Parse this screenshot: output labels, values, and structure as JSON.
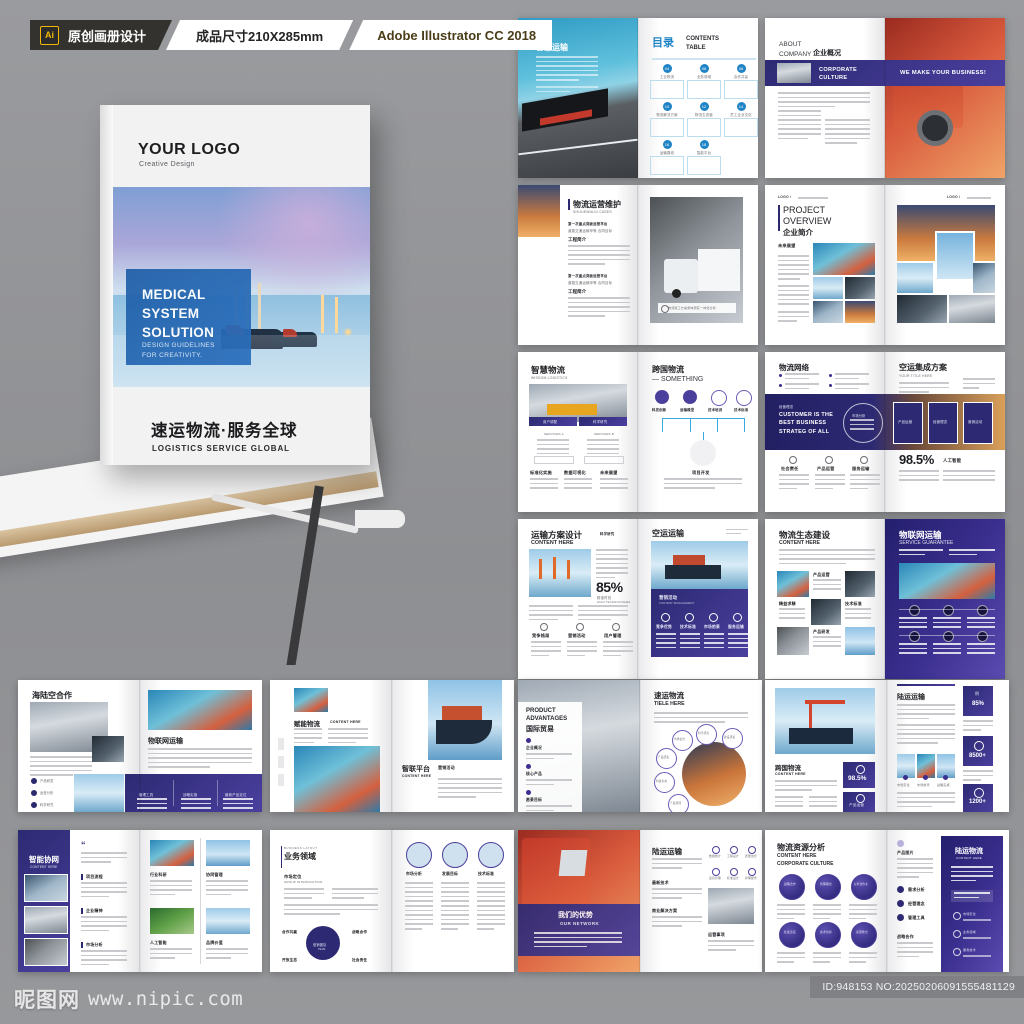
{
  "ribbon": {
    "badge": "Ai",
    "tag1": "原创画册设计",
    "tag2": "成品尺寸210X285mm",
    "tag3": "Adobe Illustrator CC 2018"
  },
  "cover": {
    "logo": "YOUR LOGO",
    "logo_sub": "Creative Design",
    "title": "MEDICAL\nSYSTEM\nSOLUTION",
    "subtitle": "DESIGN GUIDELINES\nFOR CREATIVITY.",
    "bottom_cn": "速运物流·服务全球",
    "bottom_en": "LOGISTICS SERVICE GLOBAL"
  },
  "watermark": {
    "site_cn": "昵图网",
    "site_url": "www.nipic.com",
    "id_text": "ID:948153 NO:20250206091555481129"
  },
  "spreads": [
    {
      "id": "spread-contents",
      "left_title": "智慧运输",
      "left_quote": "“",
      "right_title_cn": "目录",
      "right_title_en": "CONTENTS\nTABLE",
      "toc_items": [
        {
          "num": "04",
          "label": "工业物流"
        },
        {
          "num": "06",
          "label": "业务领域"
        },
        {
          "num": "08",
          "label": "合作共赢"
        },
        {
          "num": "10",
          "label": "物流解决方案"
        },
        {
          "num": "12",
          "label": "物流生态链"
        },
        {
          "num": "14",
          "label": "员工企业文化"
        },
        {
          "num": "16",
          "label": "运输路线"
        },
        {
          "num": "18",
          "label": "智能平台"
        }
      ],
      "accent": "#1f84c6"
    },
    {
      "id": "spread-about",
      "left_title_en": "ABOUT\nCOMPANY",
      "left_title_cn": "企业概况",
      "band_title": "CORPORATE\nCULTURE",
      "band_slogan": "WE MAKE YOUR BUSINESS!",
      "accent": "#2b2a70"
    },
    {
      "id": "spread-ops",
      "left_title_cn": "物流运营维护",
      "left_title_en": "SHIJUEWULIU CASES",
      "sec1": "第一次重点突破运营平台",
      "sec1b": "道路交通运输甲等 合同目标",
      "sec1c": "工程简介",
      "sec2": "第一次重点突破运营平台",
      "sec2b": "道路交通运输甲等 合同目标",
      "sec2c": "工程简介",
      "caption": "物流施工方案整体研究一体化分析",
      "accent": "#2b2a70"
    },
    {
      "id": "spread-project",
      "logo_mark": "LOGO /",
      "title_en": "PROJECT\nOVERVIEW",
      "title_cn": "企业简介",
      "sec": "未来展望",
      "accent": "#2b2a70"
    },
    {
      "id": "spread-smart",
      "left_title": "智慧物流",
      "left_sub": "WISDOM LOGISTICS",
      "tab1": "用户调配",
      "tab2": "科学研究",
      "svcA": "SERVICES A",
      "svcB": "SERVICES B",
      "foot": [
        "标准化实施",
        "数据可视化",
        "未来展望"
      ],
      "right_title_cn": "跨国物流",
      "right_title_en": "— SOMETHING",
      "icons": [
        "科技创新",
        "运输模型",
        "技术培训",
        "技术标准"
      ],
      "center_label": "项目开发",
      "accent": "#5b4aa8"
    },
    {
      "id": "spread-network",
      "left_title": "物流网络",
      "right_title_cn": "空运集成方案",
      "right_title_en": "YOUR TITLE HERE",
      "band_cn": "经营理念",
      "band_en": "CUSTOMER IS THE\nBEST BUSINESS\nSTRATEG OF ALL",
      "ring_label": "市场分析",
      "cards": [
        "产品运营",
        "经营理念",
        "营销活动"
      ],
      "foot": [
        "社会责任",
        "产品运营",
        "服务运输"
      ],
      "stat": "98.5%",
      "stat_label": "人工智能",
      "accent": "#2b2a70"
    },
    {
      "id": "spread-plan",
      "left_title_cn": "运输方案设计",
      "left_title_en": "CONTENT HERE",
      "left_tag": "科学研究",
      "stat": "85%",
      "stat_cn": "精准时效",
      "stat_en": "HIGH TECHNOLOGIES",
      "foot": [
        "竞争格局",
        "营销活动",
        "用户管理"
      ],
      "right_title": "空运运输",
      "right_band_cn": "营销活动",
      "right_band_en": "CONTENT MANAGEMENT",
      "right_cols": [
        "竞争优势",
        "技术标准",
        "市场前景",
        "服务运输"
      ],
      "accent": "#2b2a70"
    },
    {
      "id": "spread-eco",
      "left_title_cn": "物流生态建设",
      "left_title_en": "CONTENT HERE",
      "cells": [
        "产品运营",
        "精益求精",
        "技术标准",
        "产品研发"
      ],
      "right_title_cn": "物联网运输",
      "right_title_en": "SERVICE GUARANTEE",
      "accent": "#3b2f8f"
    },
    {
      "id": "spread-sea-air",
      "left_title": "海陆空合作",
      "right_title": "物联网运输",
      "list": [
        "产品研发",
        "运营分析",
        "科学研究"
      ],
      "band_items": [
        "管理工具",
        "战略实施",
        "最新产品定位"
      ],
      "accent": "#2b2a70"
    },
    {
      "id": "spread-empower",
      "left_title_cn": "赋能物流",
      "left_title_en": "CONTENT HERE",
      "right_title_cn": "智联平台",
      "right_title_en": "CONTENT HERE",
      "right_sub": "营销活动",
      "accent": "#2b2a70"
    },
    {
      "id": "spread-advantages",
      "left_title_en": "PRODUCT\nADVANTAGES",
      "left_title_cn": "国际贸易",
      "left_items": [
        "企业概况",
        "核心产品",
        "愿景目标"
      ],
      "right_title_cn": "速运物流",
      "right_title_en": "TIELE HERE",
      "bubbles": [
        "市场定位",
        "科学研究",
        "建设研发",
        "产品研发",
        "科技生态",
        "产品管理"
      ],
      "accent": "#4a3f9e"
    },
    {
      "id": "spread-cross",
      "left_title_cn": "跨国物流",
      "left_title_en": "CONTENT HERE",
      "left_stat": "98.5%",
      "left_stat2": "产品运营",
      "right_title": "陆运运输",
      "stats": [
        {
          "label": "例",
          "value": "85%"
        },
        {
          "label": "",
          "value": "8500+"
        },
        {
          "label": "",
          "value": "1200+"
        }
      ],
      "thumbs": [
        "市场定位",
        "市场前景",
        "战略实施"
      ],
      "accent": "#3b2f8f"
    },
    {
      "id": "spread-collab",
      "left_title_cn": "智能协网",
      "left_title_en": "CONTENT HERE",
      "mid_items": [
        "项目流程",
        "企业精神",
        "市场分析"
      ],
      "right_items": [
        "行业科研",
        "协同管理",
        "人工智能",
        "品牌价值"
      ],
      "accent": "#2b2a70"
    },
    {
      "id": "spread-business",
      "left_kicker": "BUSINESS LAYOUT",
      "left_title": "业务领域",
      "left_sec_cn": "市场定位",
      "left_sec_en": "GROUP INTRODUCTION",
      "nodes": [
        "合作共赢",
        "战略合作",
        "开放生态",
        "社会责任"
      ],
      "bubble_cn": "营销团队",
      "bubble_en": "TEAM",
      "right_cards": [
        "市场分析",
        "发展目标",
        "技术标准"
      ],
      "accent": "#2d2a73"
    },
    {
      "id": "spread-network2",
      "band_cn": "我们的优势",
      "band_en": "OUR NETWORK",
      "right_title": "陆运运输",
      "right_icons": [
        "数据统计",
        "工程设计",
        "质量监控",
        "运营管理",
        "标准设计",
        "护理服务"
      ],
      "sec2": "最新技术",
      "sec3": "商业解决方案",
      "sec4": "运营事项",
      "accent": "#3b2f8f"
    },
    {
      "id": "spread-resource",
      "left_title_cn": "物流资源分析",
      "left_title_en": "CONTENT HERE",
      "left_title_en2": "CORPORATE CULTURE",
      "badges": [
        "战略合作",
        "管理理念",
        "标准化作业",
        "社会责任",
        "技术创新",
        "资源整合"
      ],
      "mid_title": "产品图片",
      "mid_items": [
        "需求分析",
        "经营理念",
        "管理工具"
      ],
      "mid_sec": "战略合作",
      "right_title_cn": "陆运物流",
      "right_title_en": "CONTENT HERE",
      "right_items": [
        "市场定位",
        "业务领域",
        "服务技术"
      ],
      "accent": "#3b2f8f"
    }
  ]
}
